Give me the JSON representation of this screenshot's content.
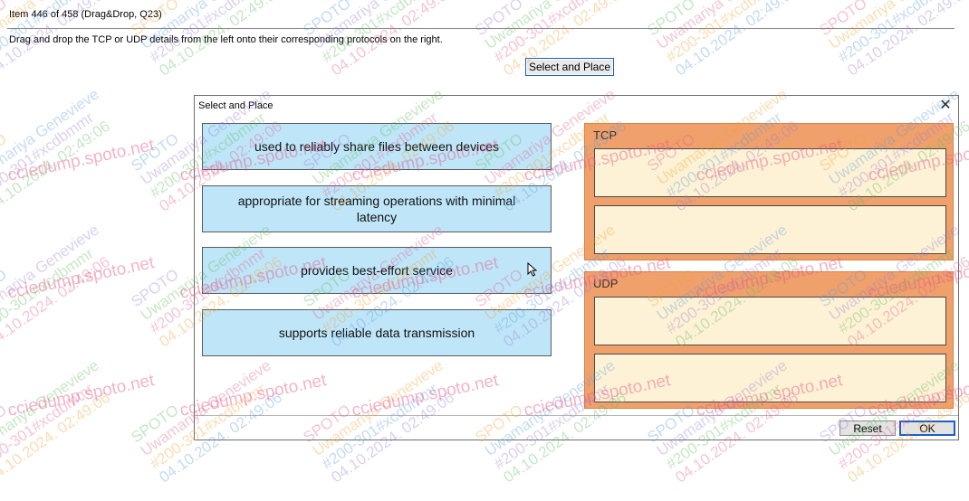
{
  "header": {
    "item_label": "Item 446 of 458  (Drag&Drop, Q23)",
    "instructions": "Drag and drop the TCP or UDP details from the left onto their corresponding protocols on the right."
  },
  "launch_button": "Select and Place",
  "dialog": {
    "title": "Select and Place",
    "source_items": [
      "used to reliably share files between devices",
      "appropriate for streaming operations with minimal latency",
      "provides best-effort service",
      "supports reliable data transmission"
    ],
    "targets": [
      {
        "label": "TCP",
        "slots": 2
      },
      {
        "label": "UDP",
        "slots": 2
      }
    ],
    "buttons": {
      "reset": "Reset",
      "ok": "OK"
    }
  },
  "watermark": {
    "lines": [
      "SPOTO",
      "Uwamariya Genevieve",
      "#200-301#xcdbmmr",
      "04.10.2024. 02:49:06"
    ],
    "site": "cciedump.spoto.net",
    "colors": [
      "#e05a8a",
      "#f0a030",
      "#5a9ad8",
      "#9a7ad0",
      "#60b860"
    ]
  },
  "colors": {
    "source_bg": "#bfe6f8",
    "panel_bg": "#f0a06b",
    "slot_bg": "#fdf2d5",
    "focus_border": "#1f5fbf"
  }
}
